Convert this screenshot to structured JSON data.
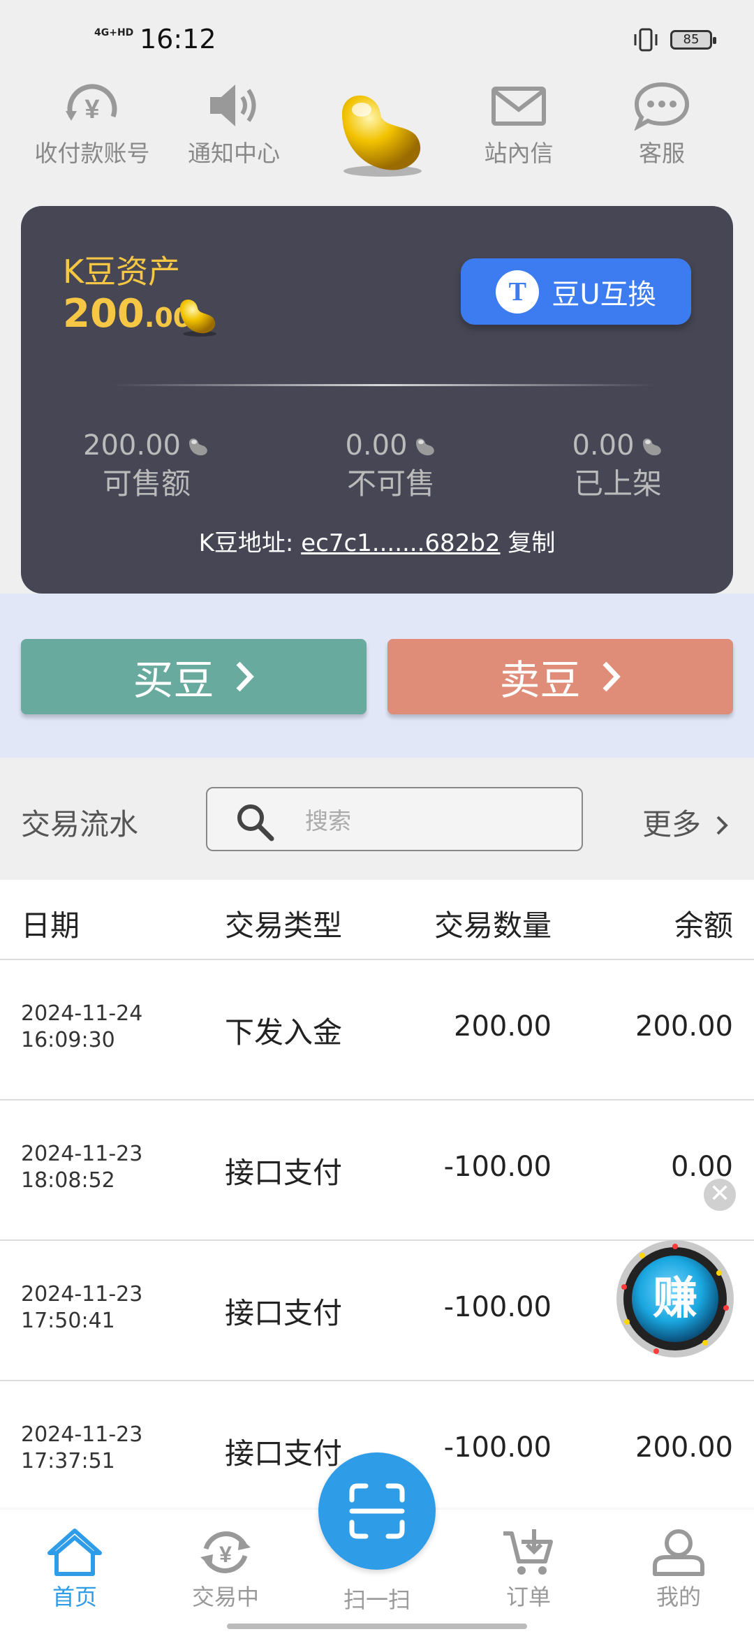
{
  "status_bar": {
    "network": "4G+HD",
    "time": "16:12",
    "battery": "85"
  },
  "top_icons": [
    {
      "label": "收付款账号",
      "icon": "yen-refresh-icon"
    },
    {
      "label": "通知中心",
      "icon": "speaker-icon"
    },
    {
      "label": "站內信",
      "icon": "mail-icon"
    },
    {
      "label": "客服",
      "icon": "chat-icon"
    }
  ],
  "asset": {
    "title": "K豆资产",
    "amount_int": "200",
    "amount_dec": ".00",
    "swap_label": "豆U互換",
    "swap_icon_glyph": "T",
    "stats": [
      {
        "value": "200.00",
        "label": "可售额"
      },
      {
        "value": "0.00",
        "label": "不可售"
      },
      {
        "value": "0.00",
        "label": "已上架"
      }
    ],
    "address_label": "K豆地址:",
    "address_value": "ec7c1.......682b2",
    "copy_label": "复制"
  },
  "actions": {
    "buy_label": "买豆",
    "sell_label": "卖豆",
    "chevron": "›"
  },
  "transactions": {
    "title": "交易流水",
    "search_placeholder": "搜索",
    "more_label": "更多",
    "columns": {
      "date": "日期",
      "type": "交易类型",
      "amount": "交易数量",
      "balance": "余额"
    },
    "rows": [
      {
        "date": "2024-11-24",
        "time": "16:09:30",
        "type": "下发入金",
        "amount": "200.00",
        "balance": "200.00"
      },
      {
        "date": "2024-11-23",
        "time": "18:08:52",
        "type": "接口支付",
        "amount": "-100.00",
        "balance": "0.00"
      },
      {
        "date": "2024-11-23",
        "time": "17:50:41",
        "type": "接口支付",
        "amount": "-100.00",
        "balance": ""
      },
      {
        "date": "2024-11-23",
        "time": "17:37:51",
        "type": "接口支付",
        "amount": "-100.00",
        "balance": "200.00"
      }
    ]
  },
  "floating": {
    "earn_label": "赚",
    "close_glyph": "✕"
  },
  "bottom_nav": {
    "items": [
      {
        "label": "首页",
        "icon": "home-icon"
      },
      {
        "label": "交易中",
        "icon": "yen-cycle-icon"
      },
      {
        "label": "扫一扫",
        "icon": "scan-icon"
      },
      {
        "label": "订单",
        "icon": "cart-icon"
      },
      {
        "label": "我的",
        "icon": "user-icon"
      }
    ]
  },
  "colors": {
    "accent_blue": "#2f9ce8",
    "gold": "#f6c744",
    "card_bg": "#464654",
    "buy": "#68aa9e",
    "sell": "#df8c78",
    "swap": "#3d7cf0"
  }
}
